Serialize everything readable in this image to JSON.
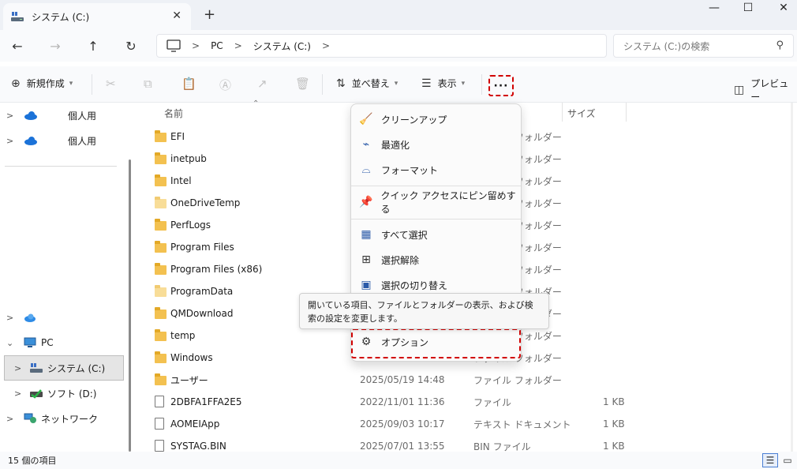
{
  "window": {
    "tab_title": "システム (C:)",
    "close_tab": "✕",
    "new_tab": "+",
    "minimize": "—",
    "maximize": "☐",
    "close": "✕"
  },
  "nav": {
    "back": "←",
    "forward": "→",
    "up": "↑",
    "refresh": "↻",
    "breadcrumb": [
      "PC",
      "システム (C:)"
    ],
    "search_placeholder": "システム (C:)の検索"
  },
  "toolbar": {
    "new_label": "新規作成",
    "sort_label": "並べ替え",
    "view_label": "表示",
    "more_label": "···",
    "preview_label": "プレビュー"
  },
  "sidebar": {
    "items": [
      {
        "label": "個人用",
        "icon": "onedrive-cloud-icon"
      },
      {
        "label": "個人用",
        "icon": "onedrive-cloud-icon"
      },
      {
        "label": "",
        "icon": "onedrive-cloud-icon"
      },
      {
        "label": "PC",
        "icon": "monitor-icon"
      },
      {
        "label": "システム (C:)",
        "icon": "drive-icon"
      },
      {
        "label": "ソフト (D:)",
        "icon": "drive-icon"
      },
      {
        "label": "ネットワーク",
        "icon": "network-icon"
      }
    ]
  },
  "columns": {
    "name": "名前",
    "size": "サイズ"
  },
  "files": [
    {
      "name": "EFI",
      "date": "",
      "type": "ファイル フォルダー",
      "size": "",
      "kind": "folder"
    },
    {
      "name": "inetpub",
      "date": "",
      "type": "ファイル フォルダー",
      "size": "",
      "kind": "folder"
    },
    {
      "name": "Intel",
      "date": "",
      "type": "ファイル フォルダー",
      "size": "",
      "kind": "folder"
    },
    {
      "name": "OneDriveTemp",
      "date": "",
      "type": "ファイル フォルダー",
      "size": "",
      "kind": "folder-light"
    },
    {
      "name": "PerfLogs",
      "date": "",
      "type": "ファイル フォルダー",
      "size": "",
      "kind": "folder"
    },
    {
      "name": "Program Files",
      "date": "",
      "type": "ファイル フォルダー",
      "size": "",
      "kind": "folder"
    },
    {
      "name": "Program Files (x86)",
      "date": "",
      "type": "ファイル フォルダー",
      "size": "",
      "kind": "folder"
    },
    {
      "name": "ProgramData",
      "date": "",
      "type": "ファイル フォルダー",
      "size": "",
      "kind": "folder-light"
    },
    {
      "name": "QMDownload",
      "date": "",
      "type": "ファイル フォルダー",
      "size": "",
      "kind": "folder"
    },
    {
      "name": "temp",
      "date": "",
      "type": "ファイル フォルダー",
      "size": "",
      "kind": "folder"
    },
    {
      "name": "Windows",
      "date": "",
      "type": "ファイル フォルダー",
      "size": "",
      "kind": "folder"
    },
    {
      "name": "ユーザー",
      "date": "2025/05/19 14:48",
      "type": "ファイル フォルダー",
      "size": "",
      "kind": "folder"
    },
    {
      "name": "2DBFA1FFA2E5",
      "date": "2022/11/01 11:36",
      "type": "ファイル",
      "size": "1 KB",
      "kind": "file"
    },
    {
      "name": "AOMEIApp",
      "date": "2025/09/03 10:17",
      "type": "テキスト ドキュメント",
      "size": "1 KB",
      "kind": "file"
    },
    {
      "name": "SYSTAG.BIN",
      "date": "2025/07/01 13:55",
      "type": "BIN ファイル",
      "size": "1 KB",
      "kind": "file"
    }
  ],
  "menu": {
    "items": [
      {
        "label": "クリーンアップ",
        "icon": "broom-icon"
      },
      {
        "label": "最適化",
        "icon": "optimize-drive-icon"
      },
      {
        "label": "フォーマット",
        "icon": "format-drive-icon"
      },
      {
        "label": "クイック アクセスにピン留めする",
        "icon": "pin-icon"
      },
      {
        "label": "すべて選択",
        "icon": "select-all-icon"
      },
      {
        "label": "選択解除",
        "icon": "select-none-icon"
      },
      {
        "label": "選択の切り替え",
        "icon": "invert-selection-icon"
      }
    ],
    "options_label": "オプション"
  },
  "tooltip": {
    "text": "開いている項目、ファイルとフォルダーの表示、および検索の設定を変更します。"
  },
  "status": {
    "item_count": "15 個の項目"
  }
}
